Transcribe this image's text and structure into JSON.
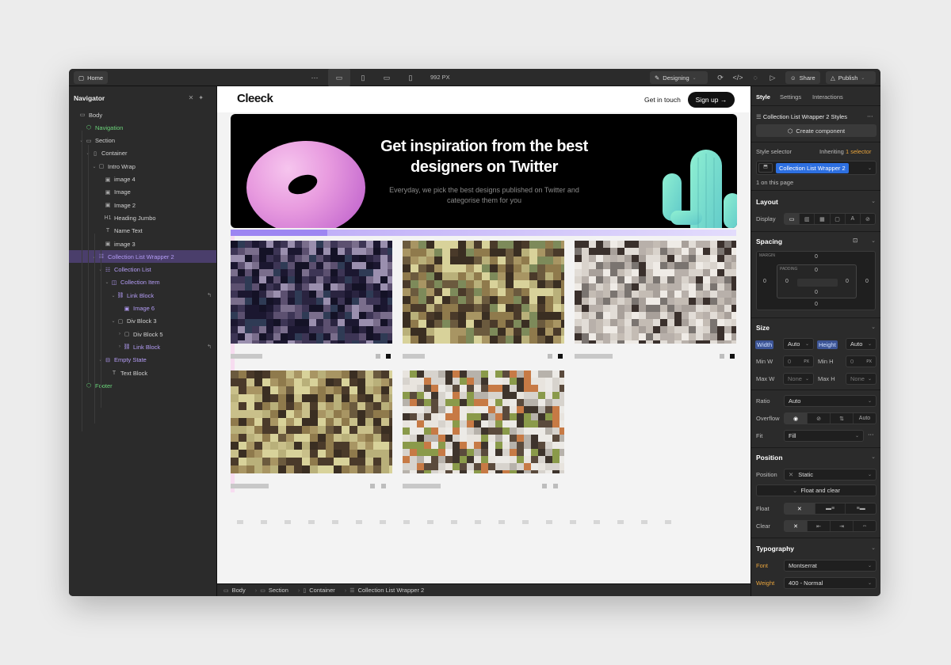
{
  "topbar": {
    "home_label": "Home",
    "more": "⋯",
    "width_readout": "992 PX",
    "mode_label": "Designing",
    "share_label": "Share",
    "publish_label": "Publish"
  },
  "navigator": {
    "title": "Navigator",
    "items": [
      {
        "label": "Body",
        "icon": "body-icon"
      },
      {
        "label": "Navigation",
        "icon": "component-icon"
      },
      {
        "label": "Section",
        "icon": "section-icon"
      },
      {
        "label": "Container",
        "icon": "container-icon"
      },
      {
        "label": "Intro Wrap",
        "icon": "div-icon"
      },
      {
        "label": "image 4",
        "icon": "image-icon"
      },
      {
        "label": "Image",
        "icon": "image-icon"
      },
      {
        "label": "Image 2",
        "icon": "image-icon"
      },
      {
        "label": "Heading Jumbo",
        "icon": "heading-icon"
      },
      {
        "label": "Name Text",
        "icon": "text-icon"
      },
      {
        "label": "image 3",
        "icon": "image-icon"
      },
      {
        "label": "Collection List Wrapper 2",
        "icon": "collection-icon"
      },
      {
        "label": "Collection List",
        "icon": "collection-list-icon"
      },
      {
        "label": "Collection Item",
        "icon": "collection-item-icon"
      },
      {
        "label": "Link Block",
        "icon": "link-icon"
      },
      {
        "label": "Image 6",
        "icon": "image-icon"
      },
      {
        "label": "Div Block 3",
        "icon": "div-icon"
      },
      {
        "label": "Div Block 5",
        "icon": "div-icon"
      },
      {
        "label": "Link Block",
        "icon": "link-icon"
      },
      {
        "label": "Empty State",
        "icon": "empty-state-icon"
      },
      {
        "label": "Text Block",
        "icon": "text-icon"
      },
      {
        "label": "Footer",
        "icon": "component-icon"
      }
    ]
  },
  "canvas": {
    "logo": "Cleeck",
    "get_in_touch": "Get in touch",
    "sign_up": "Sign up →",
    "hero_title": "Get inspiration from the best designers on Twitter",
    "hero_sub": "Everyday, we pick the best designs published on Twitter and categorise them for you"
  },
  "breadcrumb": [
    "Body",
    "Section",
    "Container",
    "Collection List Wrapper 2"
  ],
  "panel": {
    "tabs": [
      "Style",
      "Settings",
      "Interactions"
    ],
    "styles_title": "Collection List Wrapper 2 Styles",
    "create_component": "Create component",
    "style_selector": "Style selector",
    "inheriting_prefix": "Inheriting",
    "inheriting_link": "1 selector",
    "selector_value": "Collection List Wrapper 2",
    "on_page": "1 on this page",
    "layout": "Layout",
    "display": "Display",
    "spacing": "Spacing",
    "margin_label": "MARGIN",
    "padding_label": "PADDING",
    "zero": "0",
    "size": "Size",
    "width": "Width",
    "height": "Height",
    "auto": "Auto",
    "min_w": "Min W",
    "min_h": "Min H",
    "max_w": "Max W",
    "max_h": "Max H",
    "px": "PX",
    "none": "None",
    "ratio": "Ratio",
    "overflow": "Overflow",
    "fit": "Fit",
    "fill": "Fill",
    "position": "Position",
    "static": "Static",
    "float_clear": "Float and clear",
    "float": "Float",
    "clear": "Clear",
    "typography": "Typography",
    "font": "Font",
    "font_value": "Montserrat",
    "weight": "Weight",
    "weight_value": "400 - Normal"
  },
  "colors": {
    "accent_blue": "#2d6fe0",
    "selection_purple": "#4a3e6b",
    "component_green": "#6bd47a",
    "warn_orange": "#e7a33c"
  }
}
